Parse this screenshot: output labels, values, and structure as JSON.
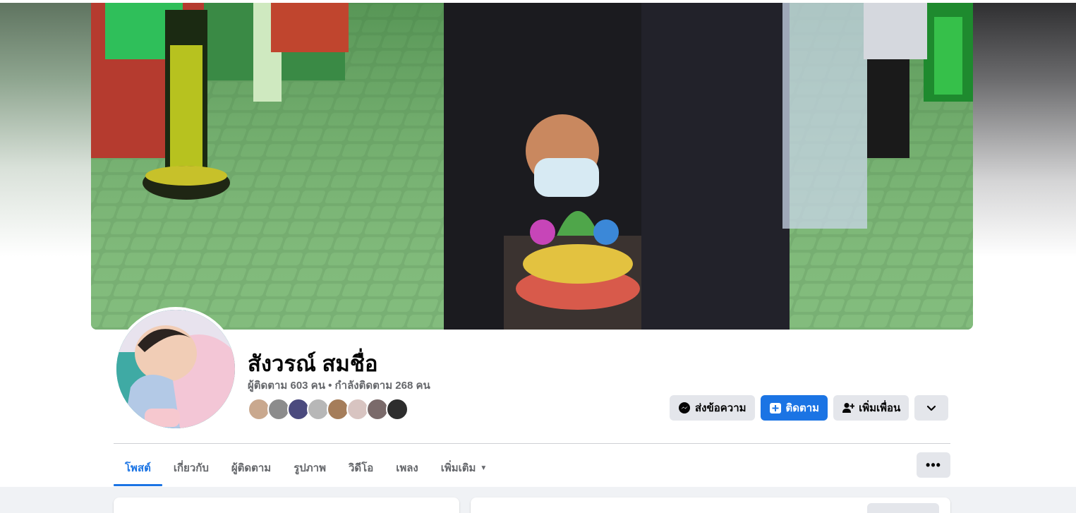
{
  "profile": {
    "name": "สังวรณ์ สมชื่อ",
    "follow_stats": "ผู้ติดตาม 603 คน • กำลังติดตาม 268 คน"
  },
  "actions": {
    "message_label": "ส่งข้อความ",
    "follow_label": "ติดตาม",
    "add_friend_label": "เพิ่มเพื่อน"
  },
  "tabs": [
    {
      "label": "โพสต์"
    },
    {
      "label": "เกี่ยวกับ"
    },
    {
      "label": "ผู้ติดตาม"
    },
    {
      "label": "รูปภาพ"
    },
    {
      "label": "วิดีโอ"
    },
    {
      "label": "เพลง"
    },
    {
      "label": "เพิ่มเติม"
    }
  ],
  "more_button_label": "•••",
  "icons": {
    "message": "messenger-icon",
    "follow": "follow-plus-icon",
    "add_friend": "add-friend-icon",
    "chevron": "chevron-down-icon",
    "tab_caret": "caret-down-icon"
  },
  "colors": {
    "accent": "#1b74e4",
    "button_gray": "#e4e6eb",
    "secondary_text": "#65676b"
  }
}
